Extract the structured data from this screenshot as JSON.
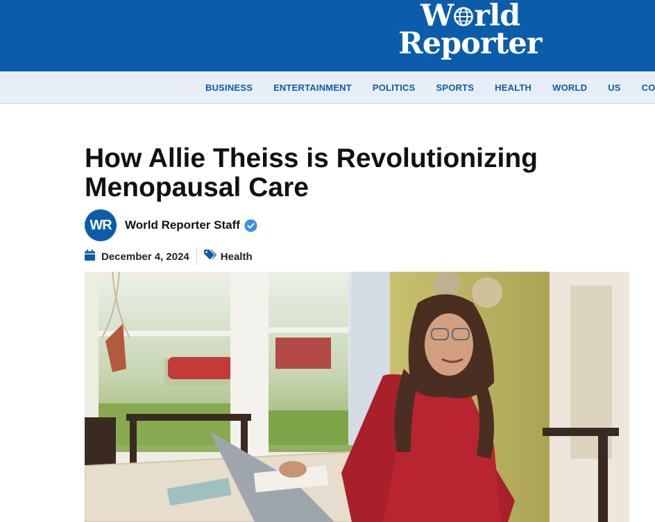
{
  "brand": {
    "line1_pre": "W",
    "line1_post": "rld",
    "line2": "Reporter"
  },
  "nav": [
    "BUSINESS",
    "ENTERTAINMENT",
    "POLITICS",
    "SPORTS",
    "HEALTH",
    "WORLD",
    "US",
    "CO"
  ],
  "article": {
    "title": "How Allie Theiss is Revolutionizing Menopausal Care",
    "author": {
      "initials": "WR",
      "name": "World Reporter Staff"
    },
    "date": "December 4, 2024",
    "category": "Health"
  },
  "icons": {
    "calendar": "calendar-icon",
    "tag": "tags-icon",
    "verified": "verified-badge-icon",
    "globe": "globe-icon"
  },
  "colors": {
    "brand_blue": "#0b5cab",
    "nav_bg": "#e8eef7",
    "verified": "#3b8fe8"
  }
}
